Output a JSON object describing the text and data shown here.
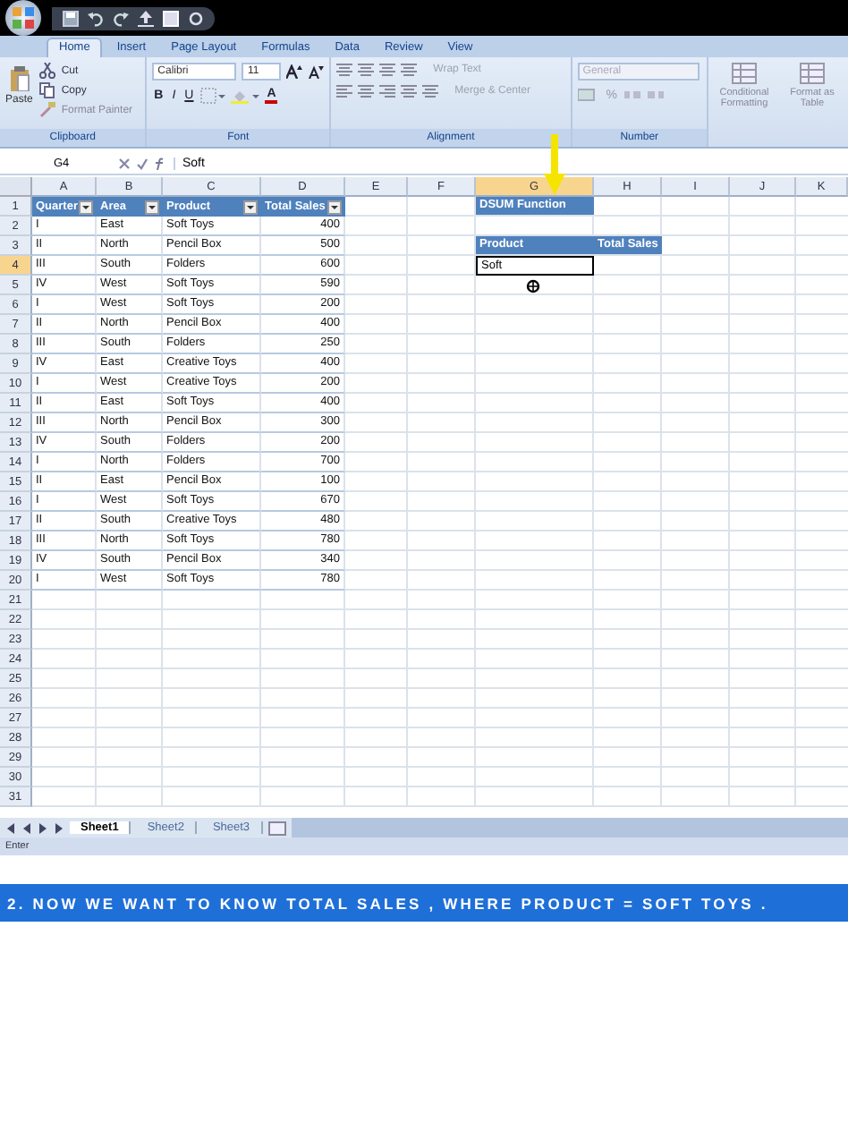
{
  "ribbon_tabs": [
    {
      "label": "Home",
      "selected": true
    },
    {
      "label": "Insert",
      "selected": false
    },
    {
      "label": "Page Layout",
      "selected": false
    },
    {
      "label": "Formulas",
      "selected": false
    },
    {
      "label": "Data",
      "selected": false
    },
    {
      "label": "Review",
      "selected": false
    },
    {
      "label": "View",
      "selected": false
    }
  ],
  "ribbon": {
    "clipboard": {
      "label": "Clipboard",
      "paste": "Paste",
      "cut": "Cut",
      "copy": "Copy",
      "format_painter": "Format Painter"
    },
    "font": {
      "label": "Font",
      "font_name": "Calibri",
      "font_size": "11",
      "bold": "B",
      "italic": "I",
      "underline": "U",
      "text_color": "A"
    },
    "alignment": {
      "label": "Alignment",
      "wrap_text": {
        "label": "Wrap Text",
        "disabled": true
      },
      "merge": {
        "label": "Merge & Center",
        "disabled": true
      }
    },
    "number": {
      "label": "Number",
      "format": "General",
      "percent": "%"
    },
    "styles": [
      {
        "label": "Conditional Formatting"
      },
      {
        "label": "Format as Table"
      }
    ]
  },
  "formula_bar": {
    "name_box": "G4",
    "value": "Soft"
  },
  "columns": [
    {
      "label": "A",
      "selected": false
    },
    {
      "label": "B",
      "selected": false
    },
    {
      "label": "C",
      "selected": false
    },
    {
      "label": "D",
      "selected": false
    },
    {
      "label": "E",
      "selected": false
    },
    {
      "label": "F",
      "selected": false
    },
    {
      "label": "G",
      "selected": true
    },
    {
      "label": "H",
      "selected": false
    },
    {
      "label": "I",
      "selected": false
    },
    {
      "label": "J",
      "selected": false
    },
    {
      "label": "K",
      "selected": false
    }
  ],
  "rows": [
    {
      "label": "1",
      "selected": false
    },
    {
      "label": "2",
      "selected": false
    },
    {
      "label": "3",
      "selected": false
    },
    {
      "label": "4",
      "selected": true
    },
    {
      "label": "5",
      "selected": false
    },
    {
      "label": "6",
      "selected": false
    },
    {
      "label": "7",
      "selected": false
    },
    {
      "label": "8",
      "selected": false
    },
    {
      "label": "9",
      "selected": false
    },
    {
      "label": "10",
      "selected": false
    },
    {
      "label": "11",
      "selected": false
    },
    {
      "label": "12",
      "selected": false
    },
    {
      "label": "13",
      "selected": false
    },
    {
      "label": "14",
      "selected": false
    },
    {
      "label": "15",
      "selected": false
    },
    {
      "label": "16",
      "selected": false
    },
    {
      "label": "17",
      "selected": false
    },
    {
      "label": "18",
      "selected": false
    },
    {
      "label": "19",
      "selected": false
    },
    {
      "label": "20",
      "selected": false
    },
    {
      "label": "21",
      "selected": false
    },
    {
      "label": "22",
      "selected": false
    },
    {
      "label": "23",
      "selected": false
    },
    {
      "label": "24",
      "selected": false
    },
    {
      "label": "25",
      "selected": false
    },
    {
      "label": "26",
      "selected": false
    },
    {
      "label": "27",
      "selected": false
    },
    {
      "label": "28",
      "selected": false
    },
    {
      "label": "29",
      "selected": false
    },
    {
      "label": "30",
      "selected": false
    },
    {
      "label": "31",
      "selected": false
    }
  ],
  "table": {
    "columns": [
      "Quarter",
      "Area",
      "Product",
      "Total Sales"
    ],
    "rows": [
      [
        "I",
        "East",
        "Soft Toys",
        "400"
      ],
      [
        "II",
        "North",
        "Pencil Box",
        "500"
      ],
      [
        "III",
        "South",
        "Folders",
        "600"
      ],
      [
        "IV",
        "West",
        "Soft Toys",
        "590"
      ],
      [
        "I",
        "West",
        "Soft Toys",
        "200"
      ],
      [
        "II",
        "North",
        "Pencil Box",
        "400"
      ],
      [
        "III",
        "South",
        "Folders",
        "250"
      ],
      [
        "IV",
        "East",
        "Creative Toys",
        "400"
      ],
      [
        "I",
        "West",
        "Creative Toys",
        "200"
      ],
      [
        "II",
        "East",
        "Soft Toys",
        "400"
      ],
      [
        "III",
        "North",
        "Pencil Box",
        "300"
      ],
      [
        "IV",
        "South",
        "Folders",
        "200"
      ],
      [
        "I",
        "North",
        "Folders",
        "700"
      ],
      [
        "II",
        "East",
        "Pencil Box",
        "100"
      ],
      [
        "I",
        "West",
        "Soft Toys",
        "670"
      ],
      [
        "II",
        "South",
        "Creative Toys",
        "480"
      ],
      [
        "III",
        "North",
        "Soft Toys",
        "780"
      ],
      [
        "IV",
        "South",
        "Pencil Box",
        "340"
      ],
      [
        "I",
        "West",
        "Soft Toys",
        "780"
      ]
    ]
  },
  "dsum": {
    "title": "DSUM Function",
    "criteria_headers": [
      "Product",
      "Total Sales"
    ],
    "criteria_value": {
      "text": "Soft",
      "active": true
    }
  },
  "sheet_tabs": [
    {
      "label": "Sheet1",
      "selected": true
    },
    {
      "label": "Sheet2",
      "selected": false
    },
    {
      "label": "Sheet3",
      "selected": false
    }
  ],
  "status_bar": "Enter",
  "caption": "2. NOW WE WANT TO KNOW TOTAL SALES , WHERE PRODUCT = SOFT TOYS ."
}
